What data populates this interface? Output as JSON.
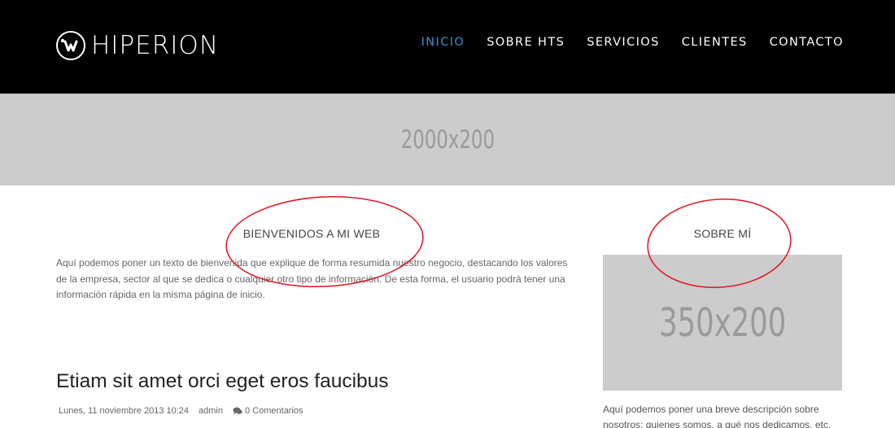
{
  "header": {
    "logo_text": "HIPERION",
    "nav": [
      {
        "label": "INICIO",
        "active": true
      },
      {
        "label": "SOBRE HTS",
        "active": false
      },
      {
        "label": "SERVICIOS",
        "active": false
      },
      {
        "label": "CLIENTES",
        "active": false
      },
      {
        "label": "CONTACTO",
        "active": false
      }
    ],
    "accent_color": "#3a8fd8"
  },
  "banner": {
    "placeholder": "2000x200"
  },
  "welcome": {
    "title": "BIENVENIDOS A MI WEB",
    "text": "Aquí podemos poner un texto de bienvenida que explique de forma resumida nuestro negocio, destacando los valores de la empresa, sector al que se dedica o cualquier otro tipo de información. De esta forma, el usuario podrá tener una información rápida en la misma página de inicio."
  },
  "post": {
    "title": "Etiam sit amet orci eget eros faucibus",
    "date": "Lunes, 11 noviembre 2013 10:24",
    "author": "admin",
    "comments": "0 Comentarios"
  },
  "sidebar": {
    "title": "SOBRE MÍ",
    "image_placeholder": "350x200",
    "text": "Aquí podemos poner una breve descripción sobre nosotros: quienes somos, a qué nos dedicamos, etc."
  },
  "annotation_color": "#e0141e"
}
